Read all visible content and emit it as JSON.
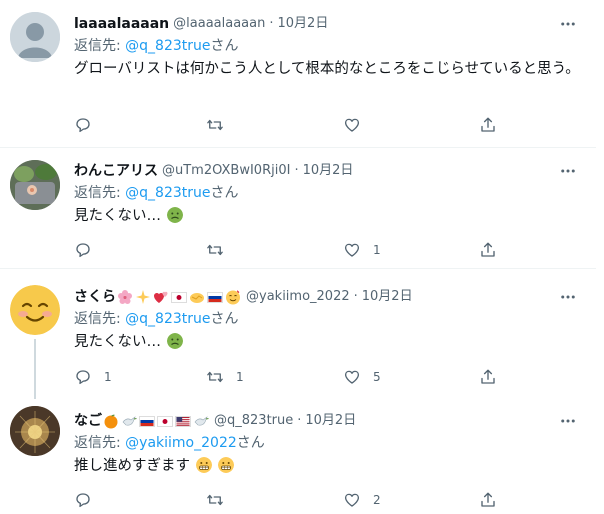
{
  "reply_prefix": "返信先:",
  "reply_suffix": "さん",
  "tweets": [
    {
      "name": "laaaalaaaan",
      "handle": "@laaaalaaaan",
      "dot": "·",
      "time": "10月2日",
      "mention": "@q_823true",
      "text": "グローバリストは何かこう人として根本的なところをこじらせていると思う。",
      "reply_count": "",
      "retweet_count": "",
      "like_count": ""
    },
    {
      "name": "わんこアリス",
      "handle": "@uTm2OXBwI0Rji0I",
      "dot": "·",
      "time": "10月2日",
      "mention": "@q_823true",
      "text": "見たくない…",
      "reply_count": "",
      "retweet_count": "",
      "like_count": "1"
    },
    {
      "name": "さくら",
      "handle": "@yakiimo_2022",
      "dot": "·",
      "time": "10月2日",
      "mention": "@q_823true",
      "text": "見たくない…",
      "reply_count": "1",
      "retweet_count": "1",
      "like_count": "5"
    },
    {
      "name": "なご",
      "handle": "@q_823true",
      "dot": "·",
      "time": "10月2日",
      "mention": "@yakiimo_2022",
      "text": "推し進めすぎます",
      "reply_count": "",
      "retweet_count": "",
      "like_count": "2"
    }
  ],
  "icons": [
    "more-icon",
    "reply-icon",
    "retweet-icon",
    "like-icon",
    "share-icon",
    "nauseated-emoji",
    "smiling-emoji",
    "grimace-emoji"
  ],
  "colors": {
    "link": "#1d9bf0",
    "muted": "#536471",
    "text": "#0f1419",
    "divider": "#eff3f4",
    "thread": "#cfd9de"
  }
}
